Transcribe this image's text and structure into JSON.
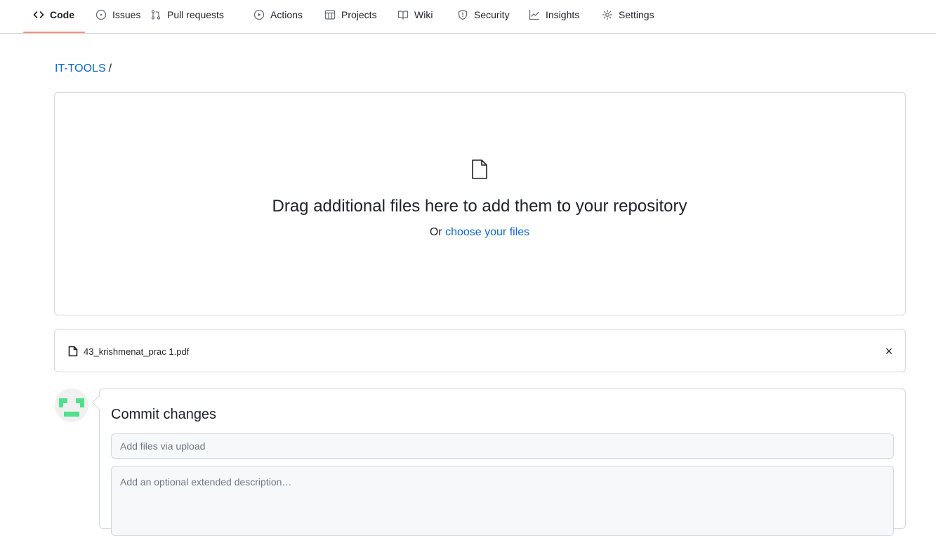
{
  "repo_nav": {
    "tabs": [
      {
        "label": "Code",
        "icon": "code-icon",
        "selected": true
      },
      {
        "label": "Issues",
        "icon": "issue-opened-icon"
      },
      {
        "label": "Pull requests",
        "icon": "git-pull-request-icon"
      },
      {
        "label": "Actions",
        "icon": "play-icon"
      },
      {
        "label": "Projects",
        "icon": "table-icon"
      },
      {
        "label": "Wiki",
        "icon": "book-icon"
      },
      {
        "label": "Security",
        "icon": "shield-icon"
      },
      {
        "label": "Insights",
        "icon": "graph-icon"
      },
      {
        "label": "Settings",
        "icon": "gear-icon"
      }
    ],
    "selected_color": "#fd8c73"
  },
  "breadcrumb": {
    "repo": "IT-TOOLS",
    "separator": "/"
  },
  "dropzone": {
    "icon": "file-icon",
    "title": "Drag additional files here to add them to your repository",
    "subtitle_prefix": "Or",
    "choose_link": "choose your files"
  },
  "uploaded_files": [
    {
      "name": "43_krishmenat_prac 1.pdf",
      "icon": "file-icon",
      "remove_icon": "x-icon",
      "remove_glyph": "×"
    }
  ],
  "commit": {
    "title": "Commit changes",
    "summary_placeholder": "Add files via upload",
    "description_placeholder": "Add an optional extended description…",
    "avatar_color": "#4fe089"
  },
  "colors": {
    "link": "#0969da",
    "border": "#d0d7de",
    "text": "#1f2328"
  }
}
